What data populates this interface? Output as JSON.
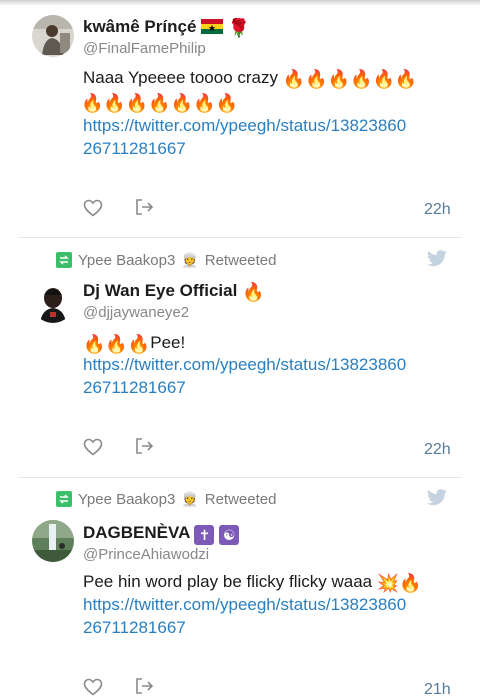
{
  "colors": {
    "link": "#2a7fc0",
    "handle": "#888888",
    "retweet_green": "#3cbf6a",
    "timestamp": "#5a7a99",
    "divider": "#e6e6e6"
  },
  "tweets": [
    {
      "display_name": "kwâmê Prínçé",
      "name_emoji": [
        "ghana-flag",
        "rose"
      ],
      "handle": "@FinalFamePhilip",
      "text": "Naaa Ypeeee toooo crazy",
      "link_line1": "https://twitter.com/ypeegh/status/13823860",
      "link_line2": "26711281667",
      "timestamp": "22h"
    },
    {
      "retweeted_by": "Ypee Baakop3",
      "retweet_label": "Retweeted",
      "display_name": "Dj Wan Eye Official",
      "handle": "@djjaywaneye2",
      "text": "Pee!",
      "link_line1": "https://twitter.com/ypeegh/status/13823860",
      "link_line2": "26711281667",
      "timestamp": "22h"
    },
    {
      "retweeted_by": "Ypee Baakop3",
      "retweet_label": "Retweeted",
      "display_name": "DAGBENÈVA",
      "handle": "@PrinceAhiawodzi",
      "text": "Pee hin word play be flicky flicky waaa",
      "link_line1": "https://twitter.com/ypeegh/status/13823860",
      "link_line2": "26711281667",
      "timestamp": "21h"
    }
  ]
}
